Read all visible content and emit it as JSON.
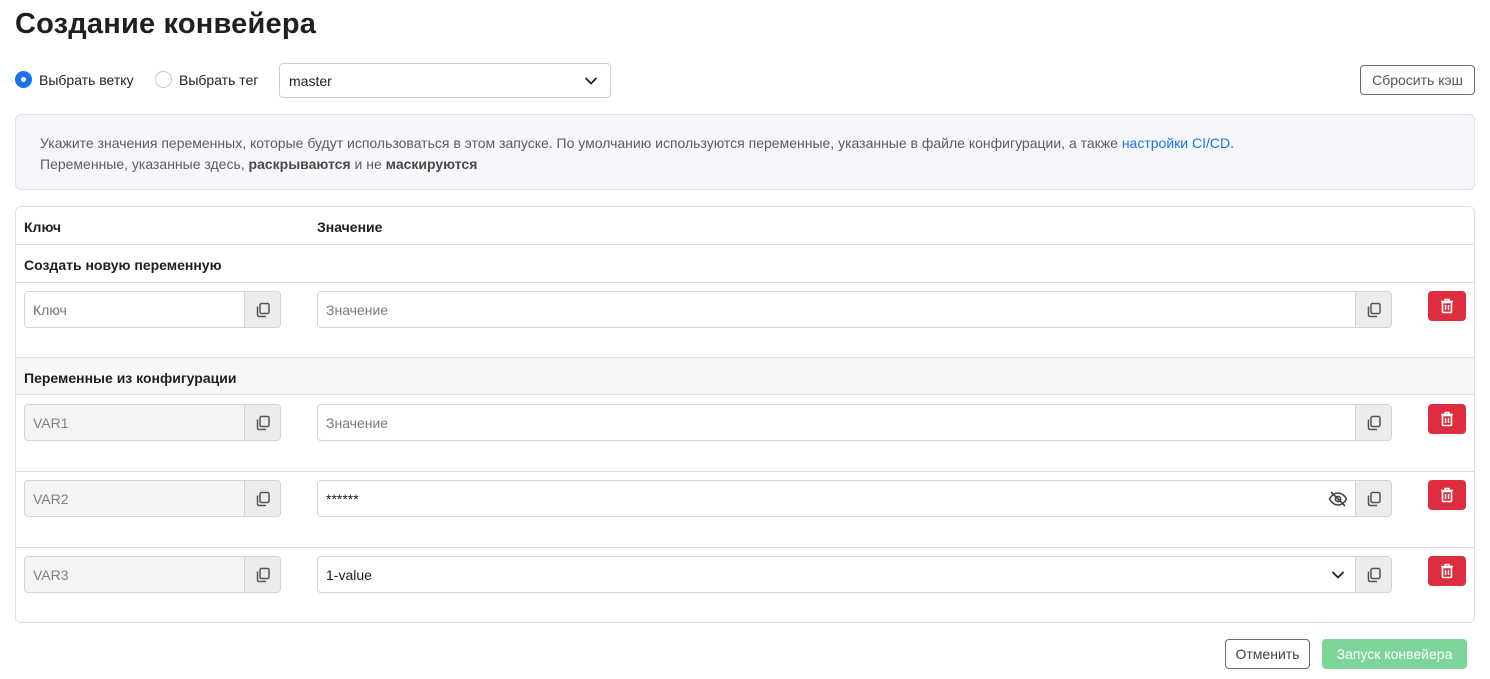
{
  "page": {
    "title": "Создание конвейера"
  },
  "ref": {
    "branch_label": "Выбрать ветку",
    "tag_label": "Выбрать тег",
    "selected": "master",
    "reset_cache_label": "Сбросить кэш"
  },
  "info": {
    "text_1": "Укажите значения переменных, которые будут использоваться в этом запуске. По умолчанию используются переменные, указанные в файле конфигурации, а также ",
    "link": "настройки CI/CD",
    "text_2": ".",
    "text_3": "Переменные, указанные здесь, ",
    "bold_1": "раскрываются",
    "text_4": " и не ",
    "bold_2": "маскируются"
  },
  "table": {
    "col_key": "Ключ",
    "col_value": "Значение",
    "new_section": "Создать новую переменную",
    "config_section": "Переменные из конфигурации",
    "new_row": {
      "key_placeholder": "Ключ",
      "value_placeholder": "Значение"
    },
    "config_rows": [
      {
        "key": "VAR1",
        "value": "",
        "value_placeholder": "Значение",
        "kind": "text"
      },
      {
        "key": "VAR2",
        "value": "******",
        "kind": "masked"
      },
      {
        "key": "VAR3",
        "value": "1-value",
        "kind": "select"
      }
    ]
  },
  "footer": {
    "cancel_label": "Отменить",
    "run_label": "Запуск конвейера"
  },
  "colors": {
    "accent": "#1a73e8",
    "danger": "#dd2d3f",
    "success_disabled": "#7ed59a"
  }
}
